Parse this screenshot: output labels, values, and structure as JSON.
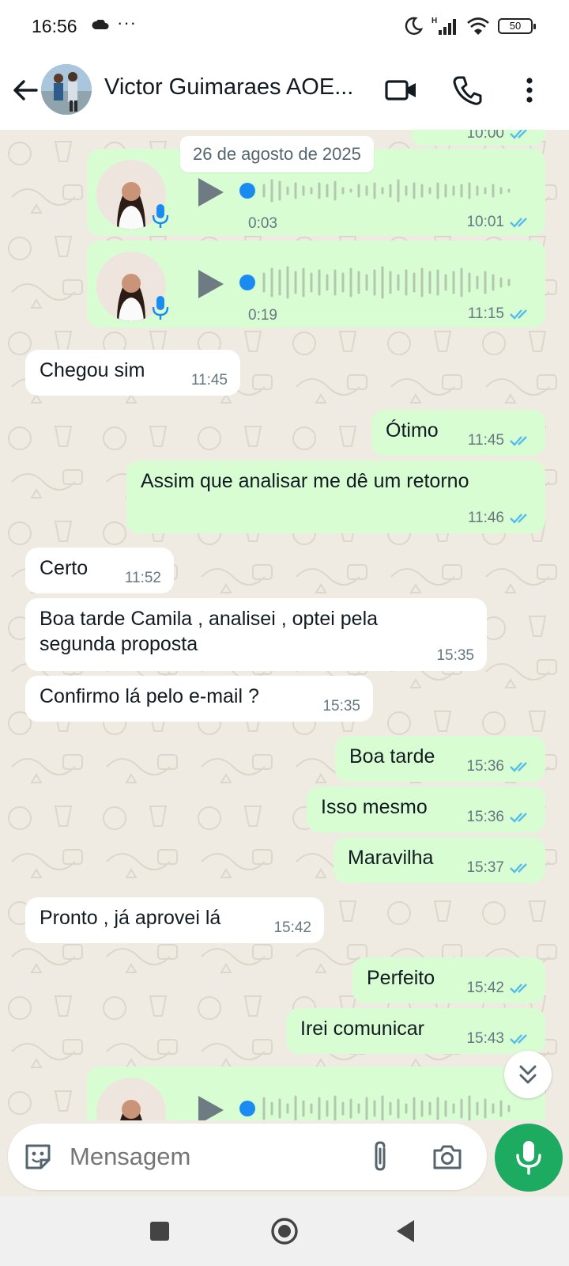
{
  "status_bar": {
    "time": "16:56",
    "dots": "···",
    "signal_label": "H",
    "battery": "50",
    "icons": [
      "cloud-icon",
      "moon-icon",
      "signal-icon",
      "wifi-icon",
      "battery-icon"
    ]
  },
  "header": {
    "contact_name": "Victor Guimaraes AOE...",
    "icons": [
      "back-arrow-icon",
      "video-call-icon",
      "phone-icon",
      "more-vert-icon"
    ]
  },
  "date_chip": "26 de agosto de 2025",
  "partial_top_time": "10:00",
  "voice_messages": [
    {
      "duration": "0:03",
      "time": "10:01",
      "progress": 0
    },
    {
      "duration": "0:19",
      "time": "11:15",
      "progress": 0
    },
    {
      "duration": "",
      "time": "",
      "progress": 0
    }
  ],
  "messages": [
    {
      "dir": "in",
      "text": "Chegou sim",
      "time": "11:45"
    },
    {
      "dir": "out",
      "text": "Ótimo",
      "time": "11:45"
    },
    {
      "dir": "out",
      "text": "Assim que analisar me dê um retorno",
      "time": "11:46"
    },
    {
      "dir": "in",
      "text": "Certo",
      "time": "11:52"
    },
    {
      "dir": "in",
      "text": "Boa tarde Camila , analisei , optei pela segunda proposta",
      "time": "15:35"
    },
    {
      "dir": "in",
      "text": "Confirmo lá pelo e-mail ?",
      "time": "15:35"
    },
    {
      "dir": "out",
      "text": "Boa tarde",
      "time": "15:36"
    },
    {
      "dir": "out",
      "text": "Isso mesmo",
      "time": "15:36"
    },
    {
      "dir": "out",
      "text": "Maravilha",
      "time": "15:37"
    },
    {
      "dir": "in",
      "text": "Pronto , já aprovei lá",
      "time": "15:42"
    },
    {
      "dir": "out",
      "text": "Perfeito",
      "time": "15:42"
    },
    {
      "dir": "out",
      "text": "Irei comunicar",
      "time": "15:43"
    }
  ],
  "composer": {
    "placeholder": "Mensagem",
    "icons": [
      "sticker-icon",
      "attach-icon",
      "camera-icon",
      "mic-icon"
    ]
  },
  "colors": {
    "outgoing_bubble": "#d9fdd3",
    "incoming_bubble": "#ffffff",
    "chat_background": "#efeae2",
    "read_ticks": "#53bdeb",
    "mic_button": "#1daa61",
    "play_dot": "#1a8bf0"
  }
}
